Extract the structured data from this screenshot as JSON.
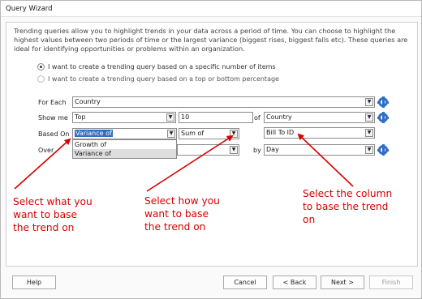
{
  "window": {
    "title": "Query Wizard"
  },
  "description": "Trending queries allow you to highlight trends in your data across a period of time. You can choose to highlight the highest values between two periods of time or the largest variance (biggest rises, biggest falls etc). These queries are ideal for identifying opportunities or problems within an organization.",
  "options": [
    {
      "label": "I want to create a trending query based on a specific number of items",
      "selected": true
    },
    {
      "label": "I want to create a trending query based on a top or bottom percentage",
      "selected": false
    }
  ],
  "form": {
    "for_each": {
      "label": "For Each",
      "value": "Country"
    },
    "show_me": {
      "label": "Show me",
      "mode": "Top",
      "count": "10",
      "of_label": "of",
      "of_value": "Country"
    },
    "based_on": {
      "label": "Based On",
      "measure": "Variance of",
      "aggregate": "Sum of",
      "column": "Bill To ID"
    },
    "over": {
      "label": "Over",
      "by_label": "by",
      "by_value": "Day"
    }
  },
  "dropdown": {
    "items": [
      "Growth of",
      "Variance of"
    ],
    "highlighted": "Variance of"
  },
  "annotations": {
    "left": [
      "Select what you",
      "want to base",
      "the trend on"
    ],
    "middle": [
      "Select how you",
      "want to base",
      "the trend on"
    ],
    "right": [
      "Select the column",
      "to base the trend",
      "on"
    ]
  },
  "annotation_color": "#d60000",
  "accent_color": "#2f6ec4",
  "buttons": {
    "help": "Help",
    "cancel": "Cancel",
    "back": "< Back",
    "next": "Next >",
    "finish": "Finish"
  },
  "icons": {
    "dropdown": "chevron-down-icon",
    "settings": "gear-icon"
  }
}
